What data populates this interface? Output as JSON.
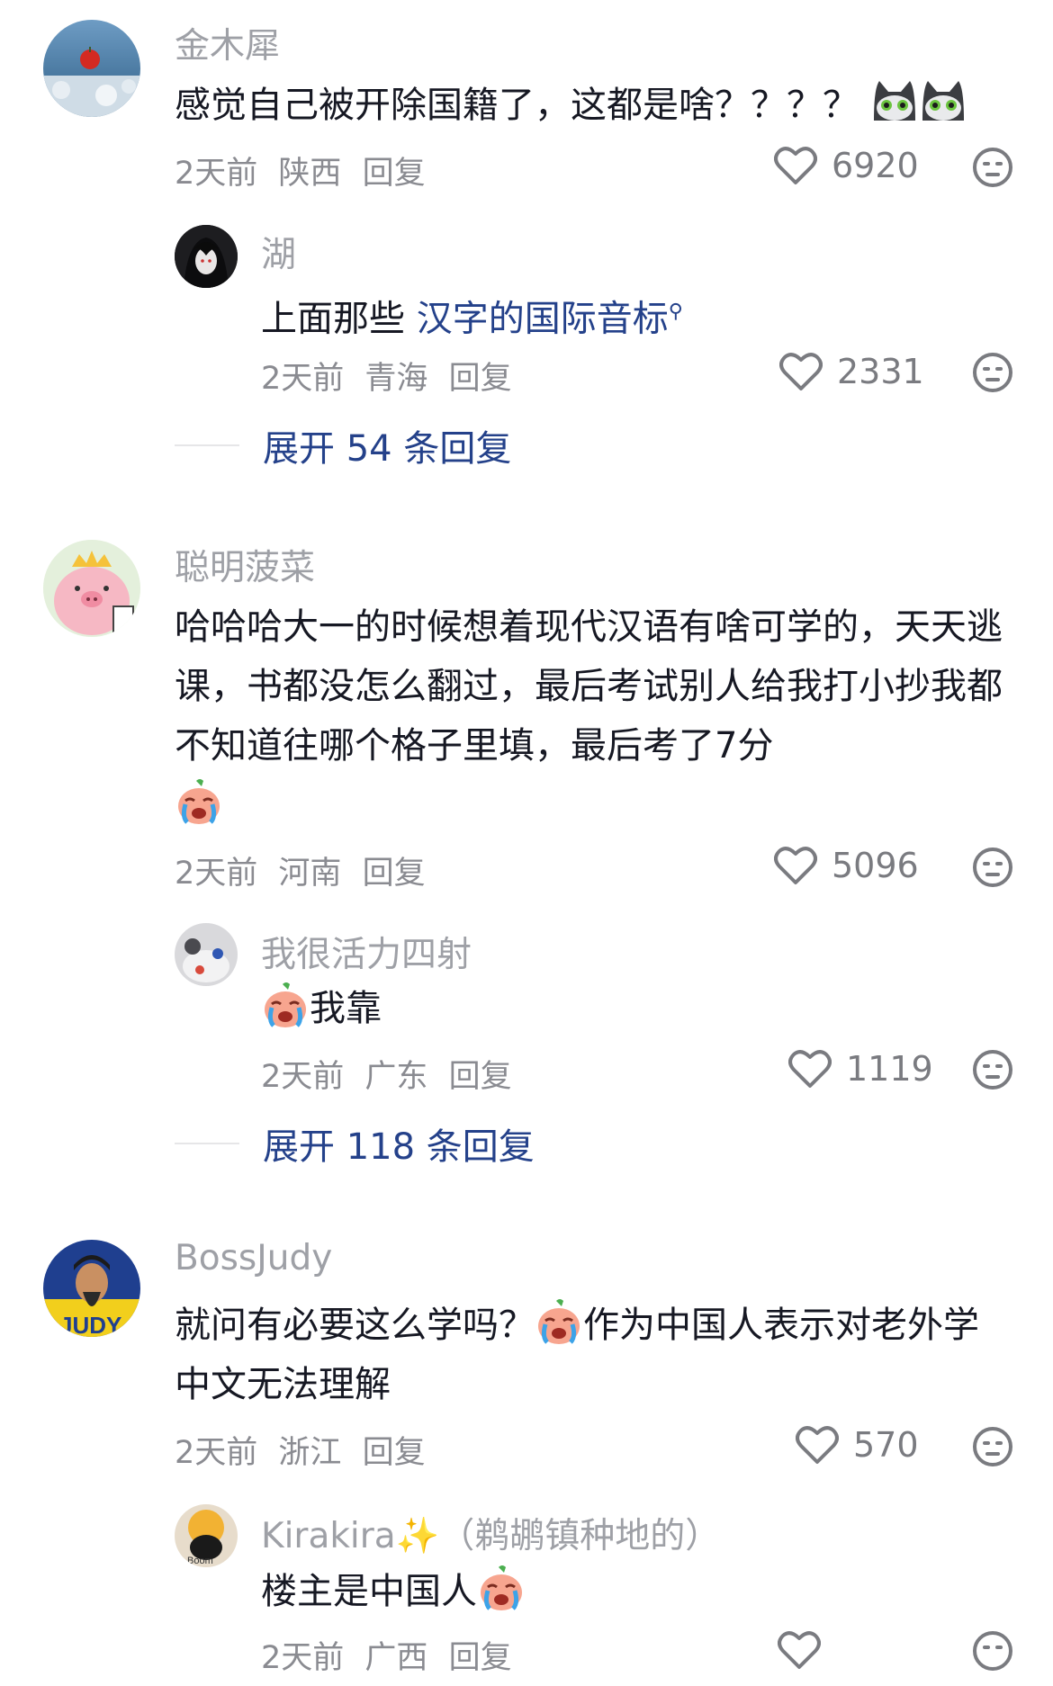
{
  "comments": [
    {
      "author": "金木犀",
      "text": "感觉自己被开除国籍了，这都是啥？？？？",
      "time": "2天前",
      "location": "陕西",
      "reply": "回复",
      "likes": "6920",
      "replies": [
        {
          "author": "湖",
          "text_prefix": "上面那些 ",
          "text_link": "汉字的国际音标",
          "time": "2天前",
          "location": "青海",
          "reply": "回复",
          "likes": "2331"
        }
      ],
      "expand": "展开 54 条回复"
    },
    {
      "author": "聪明菠菜",
      "text": "哈哈哈大一的时候想着现代汉语有啥可学的，天天逃课，书都没怎么翻过，最后考试别人给我打小抄我都不知道往哪个格子里填，最后考了7分",
      "time": "2天前",
      "location": "河南",
      "reply": "回复",
      "likes": "5096",
      "replies": [
        {
          "author": "我很活力四射",
          "text": "我靠",
          "time": "2天前",
          "location": "广东",
          "reply": "回复",
          "likes": "1119"
        }
      ],
      "expand": "展开 118 条回复"
    },
    {
      "author": "BossJudy",
      "text_a": "就问有必要这么学吗？",
      "text_b": "作为中国人表示对老外学中文无法理解",
      "time": "2天前",
      "location": "浙江",
      "reply": "回复",
      "likes": "570",
      "replies": [
        {
          "author": "Kirakira",
          "author_suffix": "（鹈鹕镇种地的）",
          "text": "楼主是中国人",
          "time": "2天前",
          "location": "广西",
          "reply": "回复"
        }
      ]
    }
  ],
  "icons": {
    "like": "heart-outline-icon",
    "dislike": "neutral-face-icon",
    "emoji_cry": "crying-face-emoji",
    "emoji_cat": "cat-emoji",
    "sparkles": "sparkles-emoji"
  }
}
